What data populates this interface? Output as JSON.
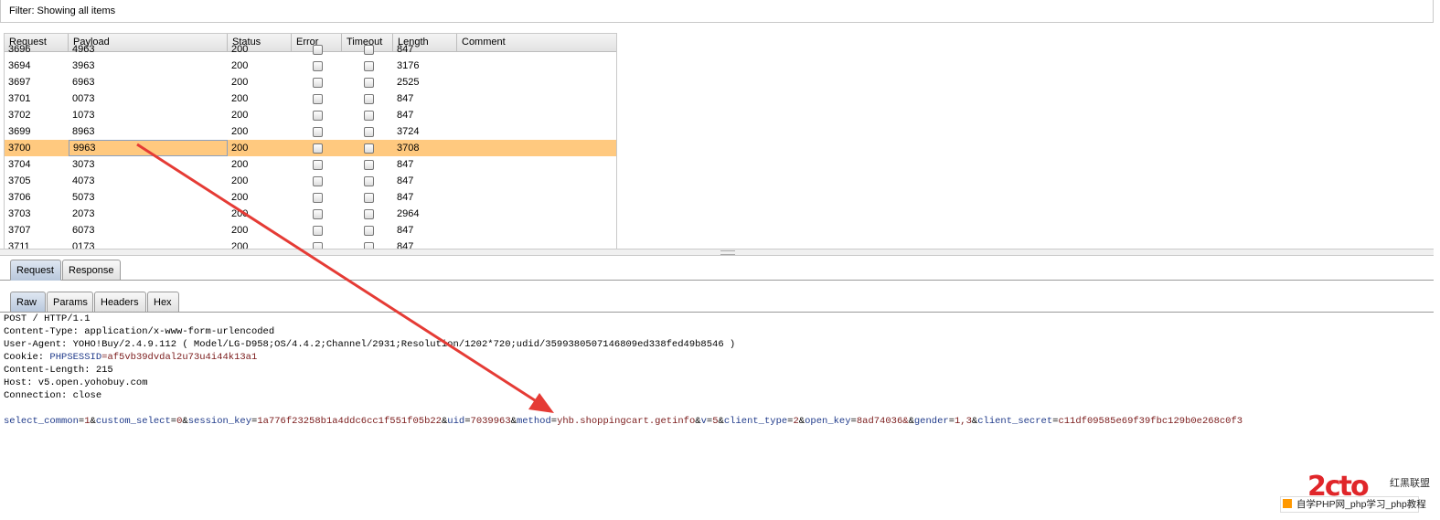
{
  "filter": {
    "text": "Filter:  Showing all items"
  },
  "table": {
    "columns": [
      "Request",
      "Payload",
      "Status",
      "Error",
      "Timeout",
      "Length",
      "Comment"
    ],
    "rows": [
      {
        "request": "3696",
        "payload": "4963",
        "status": "200",
        "length": "847",
        "selected": false
      },
      {
        "request": "3694",
        "payload": "3963",
        "status": "200",
        "length": "3176",
        "selected": false
      },
      {
        "request": "3697",
        "payload": "6963",
        "status": "200",
        "length": "2525",
        "selected": false
      },
      {
        "request": "3701",
        "payload": "0073",
        "status": "200",
        "length": "847",
        "selected": false
      },
      {
        "request": "3702",
        "payload": "1073",
        "status": "200",
        "length": "847",
        "selected": false
      },
      {
        "request": "3699",
        "payload": "8963",
        "status": "200",
        "length": "3724",
        "selected": false
      },
      {
        "request": "3700",
        "payload": "9963",
        "status": "200",
        "length": "3708",
        "selected": true
      },
      {
        "request": "3704",
        "payload": "3073",
        "status": "200",
        "length": "847",
        "selected": false
      },
      {
        "request": "3705",
        "payload": "4073",
        "status": "200",
        "length": "847",
        "selected": false
      },
      {
        "request": "3706",
        "payload": "5073",
        "status": "200",
        "length": "847",
        "selected": false
      },
      {
        "request": "3703",
        "payload": "2073",
        "status": "200",
        "length": "2964",
        "selected": false
      },
      {
        "request": "3707",
        "payload": "6073",
        "status": "200",
        "length": "847",
        "selected": false
      },
      {
        "request": "3711",
        "payload": "0173",
        "status": "200",
        "length": "847",
        "selected": false
      }
    ]
  },
  "top_tabs": {
    "request": "Request",
    "response": "Response"
  },
  "sub_tabs": {
    "raw": "Raw",
    "params": "Params",
    "headers": "Headers",
    "hex": "Hex"
  },
  "raw": {
    "request_line": "POST / HTTP/1.1",
    "content_type": "Content-Type: application/x-www-form-urlencoded",
    "user_agent": "User-Agent: YOHO!Buy/2.4.9.112 ( Model/LG-D958;OS/4.4.2;Channel/2931;Resolution/1202*720;udid/3599380507146809ed338fed49b8546 )",
    "cookie_name": "Cookie: ",
    "cookie_key": "PHPSESSID",
    "cookie_value": "=af5vb39dvdal2u73u4i44k13a1",
    "content_length": "Content-Length: 215",
    "host": "Host: v5.open.yohobuy.com",
    "connection": "Connection: close",
    "body": [
      {
        "k": "select_common",
        "v": "1"
      },
      {
        "k": "custom_select",
        "v": "0"
      },
      {
        "k": "session_key",
        "v": "1a776f23258b1a4ddc6cc1f551f05b22"
      },
      {
        "k": "uid",
        "v": "7039963"
      },
      {
        "k": "method",
        "v": "yhb.shoppingcart.getinfo"
      },
      {
        "k": "v",
        "v": "5"
      },
      {
        "k": "client_type",
        "v": "2"
      },
      {
        "k": "open_key",
        "v": "8ad74036&"
      },
      {
        "k": "gender",
        "v": "1,3"
      },
      {
        "k": "client_secret",
        "v": "c11df09585e69f39fbc129b0e268c0f3"
      }
    ]
  },
  "watermark": {
    "logo": "2cto",
    "small": "红黑联盟",
    "bar": "自学PHP网_php学习_php教程"
  },
  "colors": {
    "selected_row": "#ffc97f",
    "arrow": "#e53b35",
    "param_key": "#1f3a8a",
    "param_value": "#7a1a1a"
  }
}
